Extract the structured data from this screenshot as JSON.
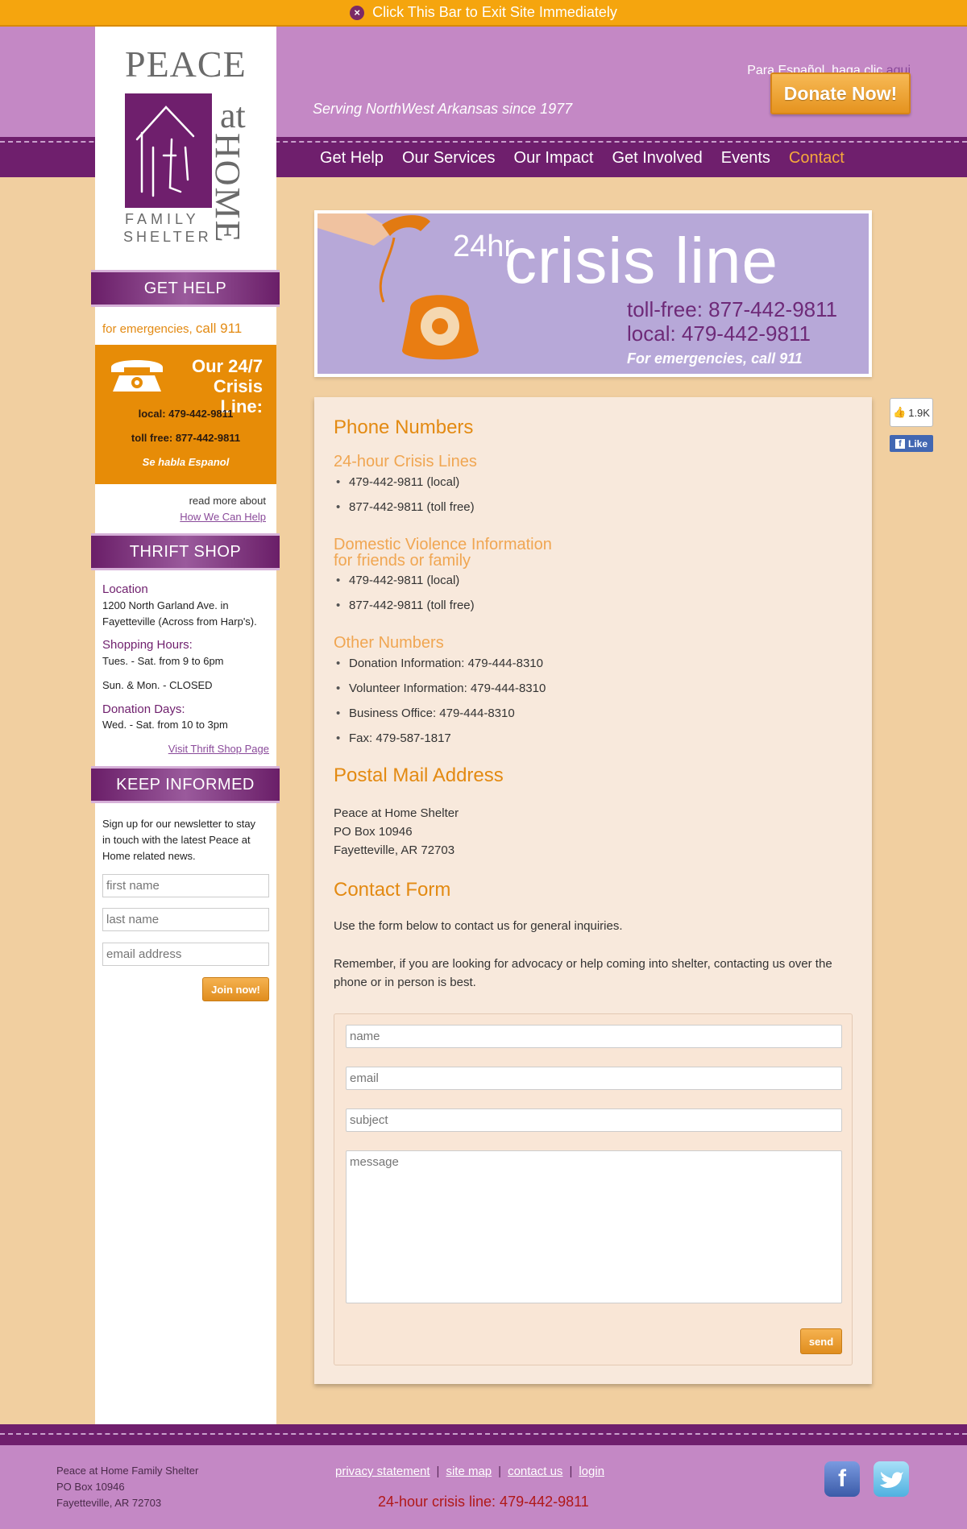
{
  "exit_bar": {
    "text": "Click This Bar to Exit Site Immediately"
  },
  "header": {
    "spanish_prefix": "Para Español, haga clic ",
    "spanish_link": "aqui",
    "donate_label": "Donate Now!",
    "tagline": "Serving NorthWest Arkansas since 1977"
  },
  "logo": {
    "peace": "PEACE",
    "at": "at",
    "home": "HOME",
    "family": "FAMILY",
    "shelter": "SHELTER"
  },
  "nav": [
    "Get Help",
    "Our Services",
    "Our Impact",
    "Get Involved",
    "Events",
    "Contact"
  ],
  "nav_active": "Contact",
  "sidebar": {
    "get_help_title": "GET HELP",
    "emergency_prefix": "for emergencies, ",
    "emergency_call": "call 911",
    "crisis_title_1": "Our 24/7",
    "crisis_title_2": "Crisis Line:",
    "crisis_local": "local: 479-442-9811",
    "crisis_tollfree": "toll free: 877-442-9811",
    "crisis_spanish": "Se habla Espanol",
    "read_more": "read more about",
    "read_more_link": "How We Can Help",
    "thrift_title": "THRIFT SHOP",
    "location_label": "Location",
    "location_text_1": "1200 North Garland Ave. in",
    "location_text_2": "Fayetteville (Across from Harp's).",
    "hours_label": "Shopping Hours:",
    "hours_text_1": "Tues. - Sat. from 9 to 6pm",
    "hours_text_2": "Sun. & Mon. - CLOSED",
    "donation_label": "Donation Days:",
    "donation_text": "Wed. - Sat. from 10 to 3pm",
    "thrift_link": "Visit Thrift Shop Page",
    "keep_title": "KEEP INFORMED",
    "keep_text_1": "Sign up for our newsletter to stay",
    "keep_text_2": "in touch with the latest Peace at",
    "keep_text_3": "Home related news.",
    "first_name_ph": "first name",
    "last_name_ph": "last name",
    "email_ph": "email address",
    "join_label": "Join now!"
  },
  "banner": {
    "hr": "24hr",
    "crisis_line": "crisis line",
    "tollfree": "toll-free: 877-442-9811",
    "local": "local: 479-442-9811",
    "emergencies": "For emergencies, call 911"
  },
  "content": {
    "phone_title": "Phone Numbers",
    "crisis_lines_title": "24-hour Crisis Lines",
    "crisis_lines": [
      "479-442-9811 (local)",
      "877-442-9811 (toll free)"
    ],
    "dv_title_1": "Domestic Violence Information",
    "dv_title_2": "for friends or family",
    "dv_lines": [
      "479-442-9811 (local)",
      "877-442-9811 (toll free)"
    ],
    "other_title": "Other Numbers",
    "other_lines": [
      "Donation Information: 479-444-8310",
      "Volunteer Information: 479-444-8310",
      "Business Office: 479-444-8310",
      "Fax: 479-587-1817"
    ],
    "postal_title": "Postal Mail Address",
    "postal_1": "Peace at Home Shelter",
    "postal_2": "PO Box 10946",
    "postal_3": "Fayetteville, AR 72703",
    "form_title": "Contact Form",
    "form_intro": "Use the form below to contact us for general inquiries.",
    "form_note": "Remember, if you are looking for advocacy or help coming into shelter, contacting us over the phone or in person is best.",
    "name_ph": "name",
    "email_ph": "email",
    "subject_ph": "subject",
    "message_ph": "message",
    "send_label": "send"
  },
  "facebook": {
    "count": "1.9K",
    "like": "Like"
  },
  "footer": {
    "addr_1": "Peace at Home Family Shelter",
    "addr_2": "PO Box 10946",
    "addr_3": "Fayetteville, AR 72703",
    "links": [
      "privacy statement",
      "site map",
      "contact us",
      "login"
    ],
    "crisis": "24-hour crisis line: 479-442-9811"
  },
  "colors": {
    "purple": "#6f1f6d",
    "lavender": "#c488c5",
    "orange": "#e38a12",
    "peach": "#f1cfa0"
  }
}
